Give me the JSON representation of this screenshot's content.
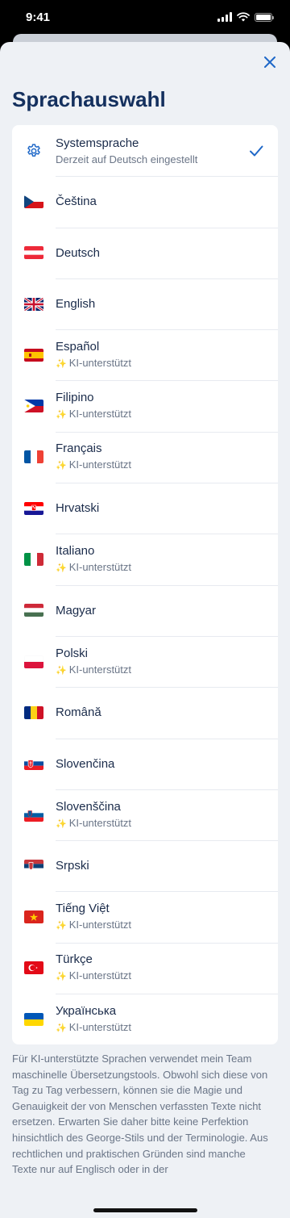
{
  "status_bar": {
    "time": "9:41"
  },
  "page_title": "Sprachauswahl",
  "system_option": {
    "label": "Systemsprache",
    "sublabel": "Derzeit auf Deutsch eingestellt",
    "selected": true
  },
  "ai_badge": "KI-unterstützt",
  "languages": [
    {
      "label": "Čeština",
      "ai": false
    },
    {
      "label": "Deutsch",
      "ai": false
    },
    {
      "label": "English",
      "ai": false
    },
    {
      "label": "Español",
      "ai": true
    },
    {
      "label": "Filipino",
      "ai": true
    },
    {
      "label": "Français",
      "ai": true
    },
    {
      "label": "Hrvatski",
      "ai": false
    },
    {
      "label": "Italiano",
      "ai": true
    },
    {
      "label": "Magyar",
      "ai": false
    },
    {
      "label": "Polski",
      "ai": true
    },
    {
      "label": "Română",
      "ai": false
    },
    {
      "label": "Slovenčina",
      "ai": false
    },
    {
      "label": "Slovenščina",
      "ai": true
    },
    {
      "label": "Srpski",
      "ai": false
    },
    {
      "label": "Tiếng Việt",
      "ai": true
    },
    {
      "label": "Türkçe",
      "ai": true
    },
    {
      "label": "Українська",
      "ai": true
    }
  ],
  "footer_note": "Für KI-unterstützte Sprachen verwendet mein Team maschinelle Übersetzungstools. Obwohl sich diese von Tag zu Tag verbessern, können sie die Magie und Genauigkeit der von Menschen verfassten Texte nicht ersetzen. Erwarten Sie daher bitte keine Perfektion hinsichtlich des George-Stils und der Terminologie. Aus rechtlichen und praktischen Gründen sind manche Texte nur auf Englisch oder in der",
  "colors": {
    "accent": "#1f68c8",
    "title": "#14305e",
    "background": "#eef1f5",
    "sparkle": "#e9b42c"
  }
}
